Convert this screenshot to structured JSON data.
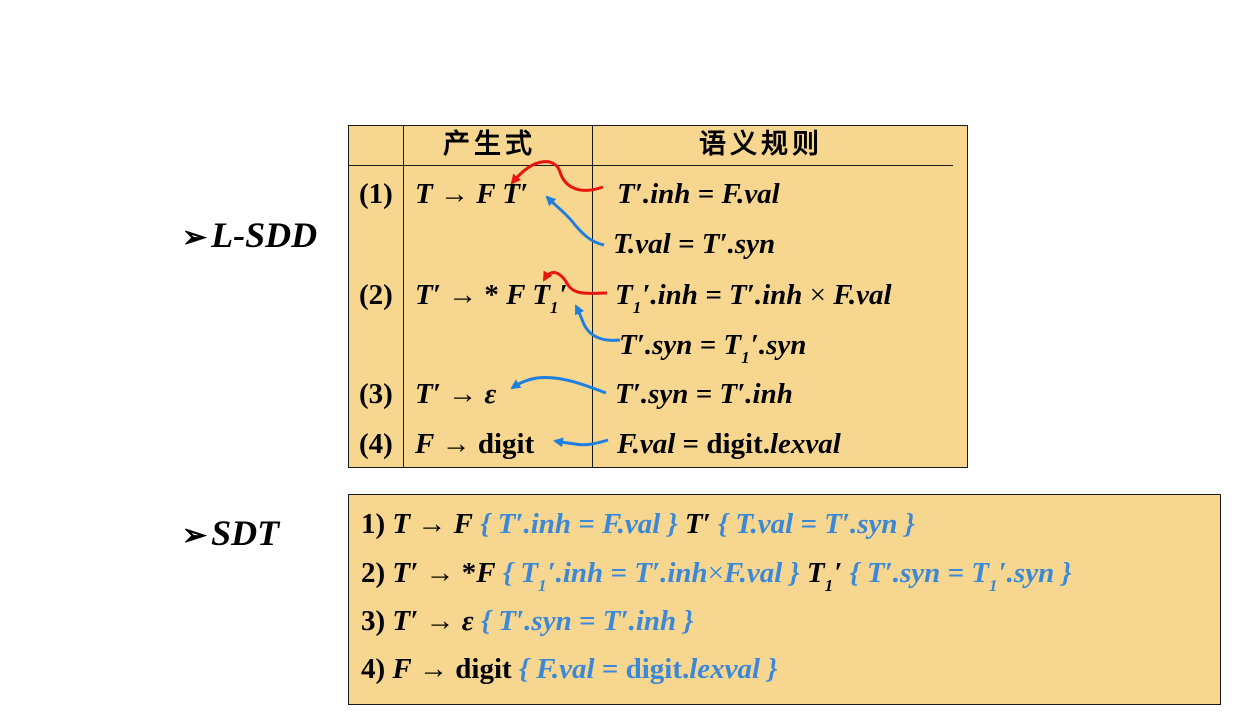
{
  "labels": {
    "lsdd": "L-SDD",
    "sdt": "SDT",
    "bullet": "➢"
  },
  "table": {
    "header_production": "产生式",
    "header_rule": "语义规则",
    "rows": [
      {
        "num": "(1)",
        "production": "T → F T′",
        "rules": [
          "T′.inh = F.val",
          "T.val = T′.syn"
        ]
      },
      {
        "num": "(2)",
        "production": "T′ → * F T1′",
        "rules": [
          "T1′.inh = T′.inh × F.val",
          "T′.syn = T1′.syn"
        ]
      },
      {
        "num": "(3)",
        "production": "T′ → ε",
        "rules": [
          "T′.syn = T′.inh"
        ]
      },
      {
        "num": "(4)",
        "production": "F → digit",
        "rules": [
          "F.val = digit.lexval"
        ]
      }
    ]
  },
  "sdt": [
    "1) T → F { T′.inh = F.val } T′ { T.val = T′.syn }",
    "2) T′ → *F { T1′.inh = T′.inh×F.val } T1′ { T′.syn = T1′.syn }",
    "3) T′ → ε { T′.syn = T′.inh }",
    "4) F → digit { F.val = digit.lexval }"
  ],
  "colors": {
    "fill": "#f7d78f",
    "blue": "#3b87d8",
    "red": "#e8140f",
    "arrow_blue": "#1e7fe0"
  }
}
